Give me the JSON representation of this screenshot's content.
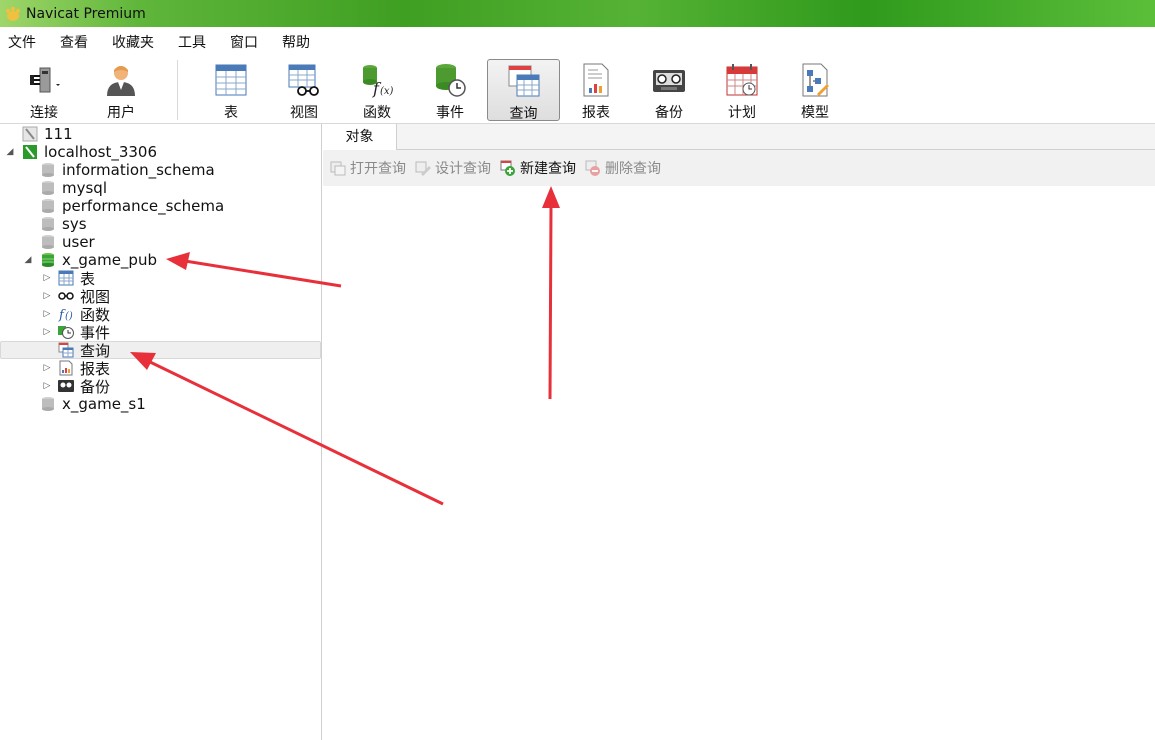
{
  "window": {
    "title": "Navicat Premium"
  },
  "menubar": {
    "items": [
      "文件",
      "查看",
      "收藏夹",
      "工具",
      "窗口",
      "帮助"
    ]
  },
  "toolbar": {
    "connect_label": "连接",
    "user_label": "用户",
    "table_label": "表",
    "view_label": "视图",
    "function_label": "函数",
    "event_label": "事件",
    "query_label": "查询",
    "report_label": "报表",
    "backup_label": "备份",
    "schedule_label": "计划",
    "model_label": "模型",
    "active": "查询"
  },
  "tree": {
    "conn1": "111",
    "conn2": "localhost_3306",
    "db_information_schema": "information_schema",
    "db_mysql": "mysql",
    "db_performance_schema": "performance_schema",
    "db_sys": "sys",
    "db_user": "user",
    "db_x_game_pub": "x_game_pub",
    "node_tables": "表",
    "node_views": "视图",
    "node_functions": "函数",
    "node_events": "事件",
    "node_queries": "查询",
    "node_reports": "报表",
    "node_backups": "备份",
    "db_x_game_s1": "x_game_s1"
  },
  "objects": {
    "tab_label": "对象",
    "open_query": "打开查询",
    "design_query": "设计查询",
    "new_query": "新建查询",
    "delete_query": "删除查询"
  },
  "colors": {
    "annotation_arrow": "#e8303a",
    "db_active": "#3aa33a",
    "conn_icon": "#2a9a2a"
  }
}
